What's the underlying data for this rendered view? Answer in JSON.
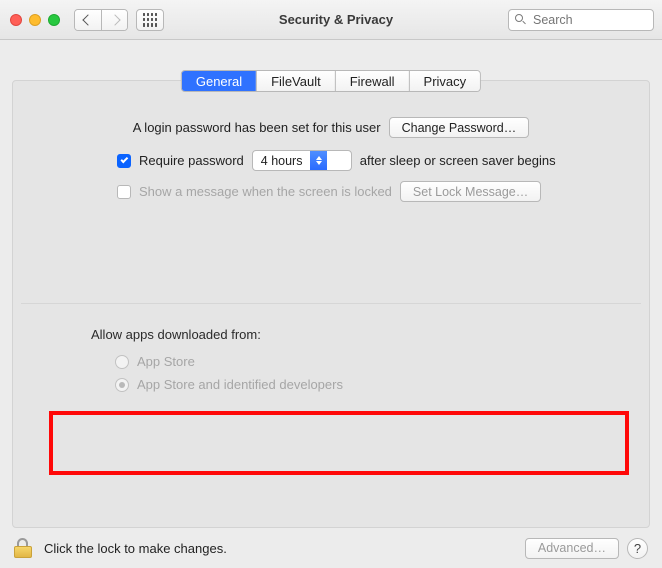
{
  "window": {
    "title": "Security & Privacy"
  },
  "toolbar": {
    "search_placeholder": "Search"
  },
  "tabs": [
    {
      "label": "General",
      "active": true
    },
    {
      "label": "FileVault",
      "active": false
    },
    {
      "label": "Firewall",
      "active": false
    },
    {
      "label": "Privacy",
      "active": false
    }
  ],
  "login": {
    "text": "A login password has been set for this user",
    "change_button": "Change Password…"
  },
  "require_password": {
    "checked": true,
    "prefix": "Require password",
    "selected_delay": "4 hours",
    "suffix": "after sleep or screen saver begins"
  },
  "lock_message": {
    "checked": false,
    "label": "Show a message when the screen is locked",
    "button": "Set Lock Message…"
  },
  "downloads": {
    "heading": "Allow apps downloaded from:",
    "options": [
      {
        "label": "App Store",
        "selected": false
      },
      {
        "label": "App Store and identified developers",
        "selected": true
      }
    ]
  },
  "footer": {
    "lock_hint": "Click the lock to make changes.",
    "advanced": "Advanced…",
    "help": "?"
  }
}
